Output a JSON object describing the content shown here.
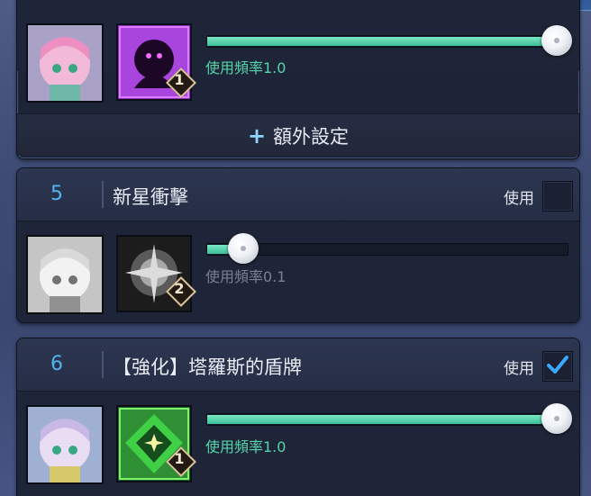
{
  "slots": [
    {
      "id": "slot-4",
      "number": "",
      "skill_name": "",
      "use_label": "",
      "enabled": true,
      "frequency_label": "使用頻率1.0",
      "frequency_value": 1.0,
      "skill_level": "1",
      "icon": "dark-shadow-skill-icon",
      "icon_colors": [
        "#c05ee6",
        "#3a0f52"
      ],
      "extra_settings_label": "額外設定"
    },
    {
      "id": "slot-5",
      "number": "5",
      "skill_name": "新星衝擊",
      "use_label": "使用",
      "enabled": false,
      "frequency_label": "使用頻率0.1",
      "frequency_value": 0.1,
      "skill_level": "2",
      "icon": "nova-impact-skill-icon",
      "icon_colors": [
        "#b9b9b9",
        "#2a2a2a"
      ]
    },
    {
      "id": "slot-6",
      "number": "6",
      "skill_name": "【強化】塔羅斯的盾牌",
      "use_label": "使用",
      "enabled": true,
      "frequency_label": "使用頻率1.0",
      "frequency_value": 1.0,
      "skill_level": "1",
      "icon": "talos-shield-skill-icon",
      "icon_colors": [
        "#59e24a",
        "#0f4a1e"
      ]
    }
  ],
  "colors": {
    "accent_number": "#4fb4ef",
    "slider_fill": "#4fd3a6",
    "frequency_enabled": "#55d6a9",
    "frequency_disabled": "#7b8190",
    "checkmark": "#3aa9ff"
  }
}
